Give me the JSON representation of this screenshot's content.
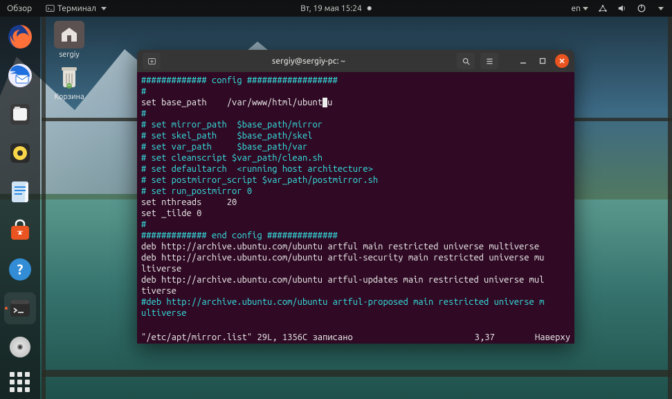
{
  "topbar": {
    "overview": "Обзор",
    "active_app": "Терминал",
    "datetime": "Вт, 19 мая  15:24",
    "lang": "en"
  },
  "desktop": {
    "home": "sergiy",
    "trash": "Корзина"
  },
  "terminal": {
    "title": "sergiy@sergiy-pc: ~",
    "lines": [
      {
        "c": "cmt",
        "t": "############# config ##################"
      },
      {
        "c": "cmt",
        "t": "#"
      },
      {
        "c": "wht",
        "t": "set base_path    /var/www/html/ubunt",
        "cursor": true,
        "tail": "u"
      },
      {
        "c": "cmt",
        "t": "#"
      },
      {
        "c": "cmt",
        "t": "# set mirror_path  $base_path/mirror"
      },
      {
        "c": "cmt",
        "t": "# set skel_path    $base_path/skel"
      },
      {
        "c": "cmt",
        "t": "# set var_path     $base_path/var"
      },
      {
        "c": "cmt",
        "t": "# set cleanscript $var_path/clean.sh"
      },
      {
        "c": "cmt",
        "t": "# set defaultarch  <running host architecture>"
      },
      {
        "c": "cmt",
        "t": "# set postmirror_script $var_path/postmirror.sh"
      },
      {
        "c": "cmt",
        "t": "# set run_postmirror 0"
      },
      {
        "c": "wht",
        "t": "set nthreads     20"
      },
      {
        "c": "wht",
        "t": "set _tilde 0"
      },
      {
        "c": "cmt",
        "t": "#"
      },
      {
        "c": "cmt",
        "t": "############# end config ##############"
      },
      {
        "c": "wht",
        "t": ""
      },
      {
        "c": "wht",
        "t": "deb http://archive.ubuntu.com/ubuntu artful main restricted universe multiverse"
      },
      {
        "c": "wht",
        "t": "deb http://archive.ubuntu.com/ubuntu artful-security main restricted universe mu"
      },
      {
        "c": "wht",
        "t": "ltiverse"
      },
      {
        "c": "wht",
        "t": "deb http://archive.ubuntu.com/ubuntu artful-updates main restricted universe mul"
      },
      {
        "c": "wht",
        "t": "tiverse"
      },
      {
        "c": "cmt",
        "t": "#deb http://archive.ubuntu.com/ubuntu artful-proposed main restricted universe m"
      },
      {
        "c": "cmt",
        "t": "ultiverse"
      }
    ],
    "status_left": "\"/etc/apt/mirror.list\" 29L, 1356C записано",
    "status_right": "3,37        Наверху"
  },
  "dock": [
    {
      "name": "firefox",
      "color": "#ff7139"
    },
    {
      "name": "thunderbird",
      "color": "#1f6fdf"
    },
    {
      "name": "files",
      "color": "#f4f4f4"
    },
    {
      "name": "rhythmbox",
      "color": "#f8d648"
    },
    {
      "name": "libreoffice-writer",
      "color": "#2d8ae0"
    },
    {
      "name": "software",
      "color": "#e95420"
    },
    {
      "name": "help",
      "color": "#338dd6"
    },
    {
      "name": "terminal",
      "color": "#2c2c2c",
      "running": true
    },
    {
      "name": "disc",
      "color": "#c8c8c8"
    }
  ]
}
